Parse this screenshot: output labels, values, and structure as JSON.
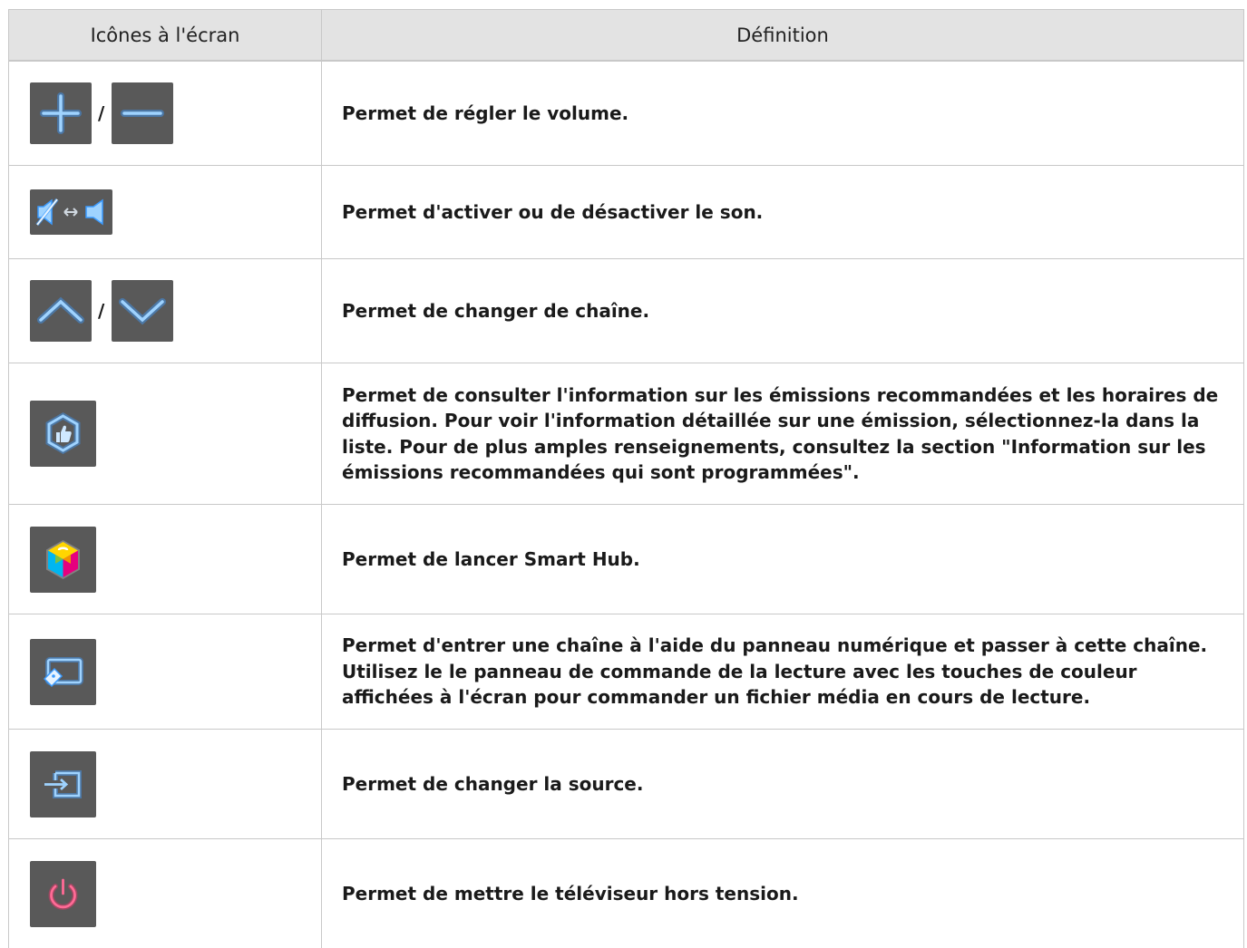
{
  "header": {
    "col_icons": "Icônes à l'écran",
    "col_definition": "Définition"
  },
  "separator": "/",
  "rows": [
    {
      "icons": [
        "plus-icon",
        "minus-icon"
      ],
      "text": "Permet de régler le volume."
    },
    {
      "icons": [
        "mute-toggle-icon"
      ],
      "text": "Permet d'activer ou de désactiver le son."
    },
    {
      "icons": [
        "chevron-up-icon",
        "chevron-down-icon"
      ],
      "text": "Permet de changer de chaîne."
    },
    {
      "icons": [
        "recommendations-icon"
      ],
      "text": "Permet de consulter l'information sur les émissions recommandées et les horaires de diffusion. Pour voir l'information détaillée sur une émission, sélectionnez-la dans la liste. Pour de plus amples renseignements, consultez la section \"Information sur les émissions recommandées qui sont programmées\"."
    },
    {
      "icons": [
        "smart-hub-icon"
      ],
      "text": "Permet de lancer Smart Hub."
    },
    {
      "icons": [
        "remote-keypad-icon"
      ],
      "text": "Permet d'entrer une chaîne à l'aide du panneau numérique et passer à cette chaîne. Utilisez le le panneau de commande de la lecture avec les touches de couleur affichées à l'écran pour commander un fichier média en cours de lecture."
    },
    {
      "icons": [
        "source-icon"
      ],
      "text": "Permet de changer la source."
    },
    {
      "icons": [
        "power-icon"
      ],
      "text": "Permet de mettre le téléviseur hors tension."
    }
  ],
  "colors": {
    "icon_bg": "#595959",
    "icon_glow": "#2e8cff",
    "power_color": "#ff2f6e",
    "header_bg": "#e3e3e3",
    "border": "#c8c8c8"
  }
}
